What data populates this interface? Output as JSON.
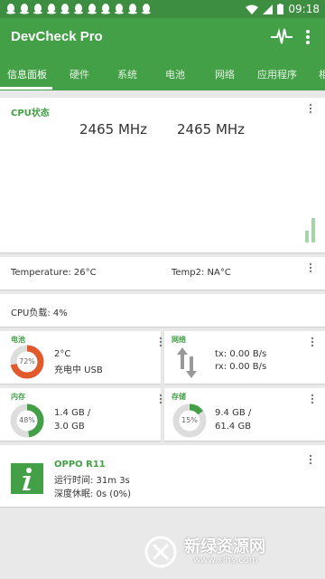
{
  "status_bar": {
    "time": "09:18"
  },
  "app": {
    "title": "DevCheck Pro"
  },
  "tabs": [
    "信息面板",
    "硬件",
    "系统",
    "电池",
    "网络",
    "应用程序",
    "相"
  ],
  "cpu": {
    "title": "CPU状态",
    "freq_left": "2465 MHz",
    "freq_right": "2465 MHz"
  },
  "temps": {
    "temperature": "Temperature: 26°C",
    "temp2": "Temp2: NA°C"
  },
  "cpu_load": "CPU负载: 4%",
  "battery": {
    "title": "电池",
    "percent": "72%",
    "percent_value": 72,
    "temp": "2°C",
    "status": "充电中 USB"
  },
  "network": {
    "title": "网络",
    "tx": "tx: 0.00 B/s",
    "rx": "rx: 0.00 B/s"
  },
  "memory": {
    "title": "内存",
    "percent": "48%",
    "percent_value": 48,
    "used": "1.4 GB /",
    "total": "3.0 GB"
  },
  "storage": {
    "title": "存储",
    "percent": "15%",
    "percent_value": 15,
    "used": "9.4 GB /",
    "total": "61.4 GB"
  },
  "device": {
    "name": "OPPO R11",
    "uptime": "运行时间: 31m 3s",
    "deep_sleep": "深度休眠: 0s (0%)"
  },
  "watermark": {
    "text": "新绿资源网",
    "url": "www.xlhs.com"
  },
  "colors": {
    "primary": "#43a047",
    "status_bar": "#3e8e41",
    "battery_ring": "#e05a2b",
    "ring_green": "#43a047"
  }
}
